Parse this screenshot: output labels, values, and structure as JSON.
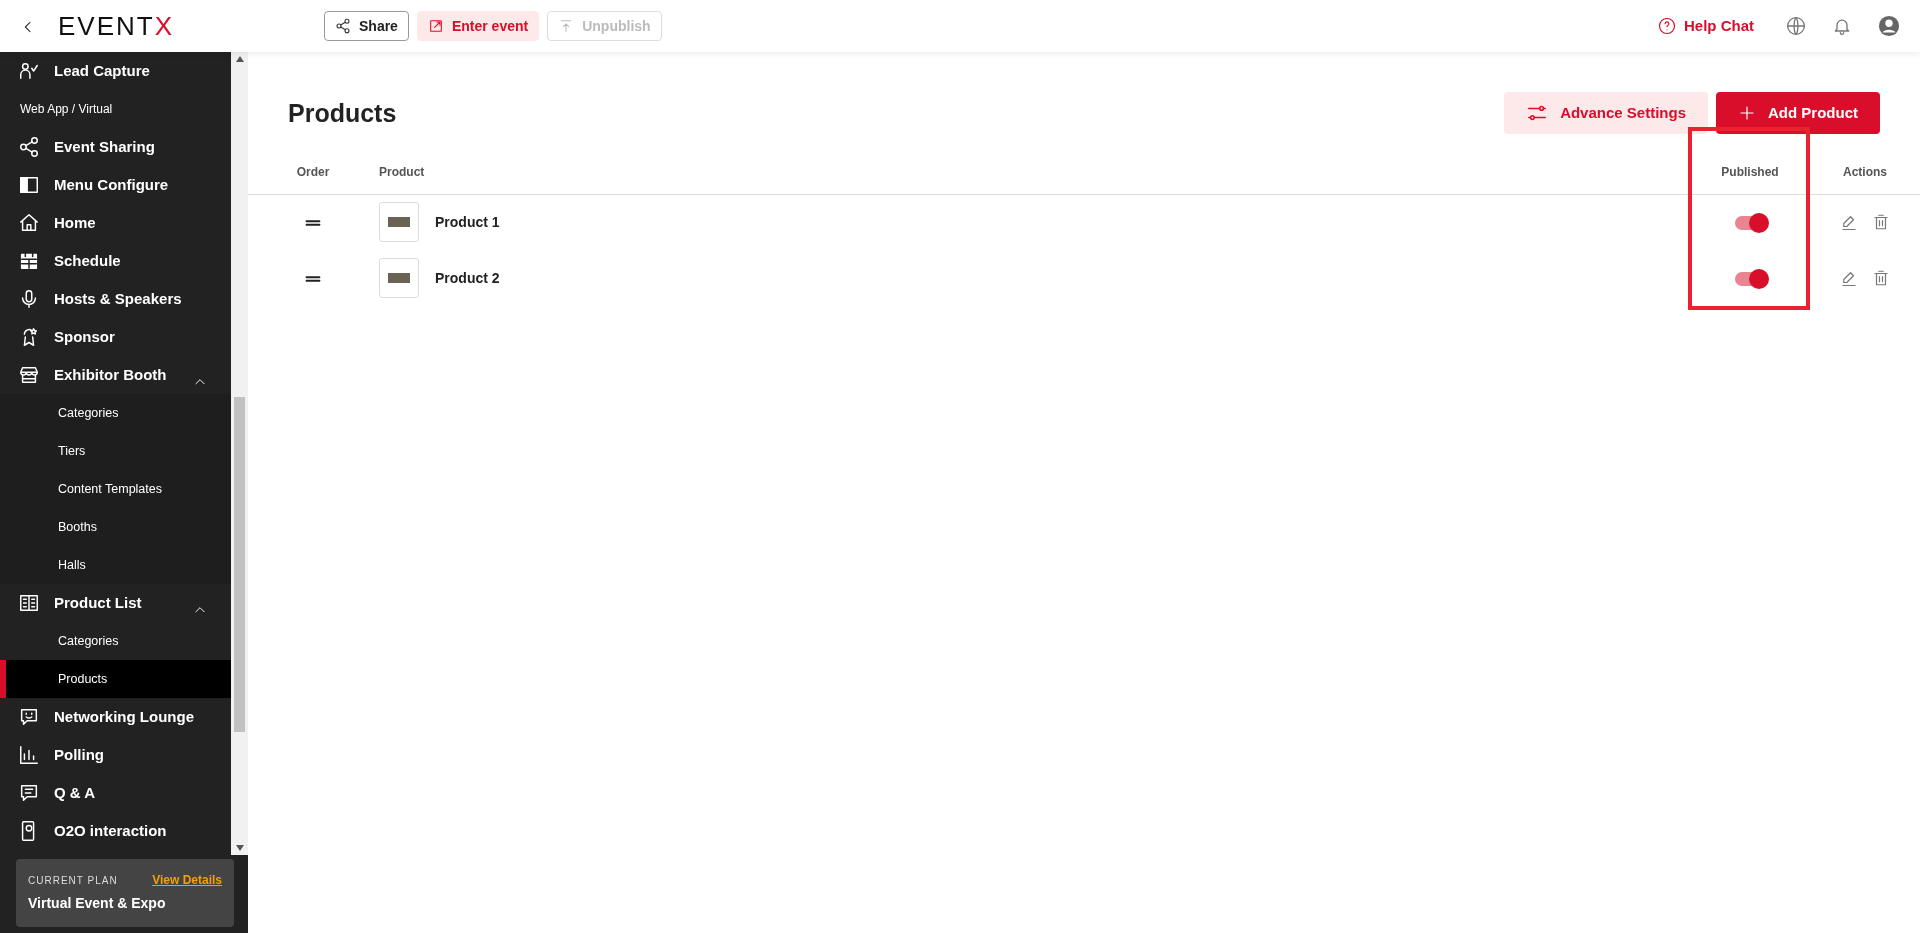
{
  "topbar": {
    "logo": {
      "text": "EVENT",
      "accent": "X"
    },
    "buttons": [
      {
        "label": "Share",
        "kind": "outline",
        "disabled": false
      },
      {
        "label": "Enter event",
        "kind": "soft",
        "disabled": false
      },
      {
        "label": "Unpublish",
        "kind": "outline",
        "disabled": true
      }
    ],
    "help": "Help Chat"
  },
  "sidebar": {
    "items": [
      {
        "kind": "item",
        "label": "Lead Capture",
        "selected": false
      },
      {
        "kind": "section",
        "label": "Web App / Virtual"
      },
      {
        "kind": "item",
        "label": "Event Sharing",
        "selected": false
      },
      {
        "kind": "item",
        "label": "Menu Configure",
        "selected": false
      },
      {
        "kind": "item",
        "label": "Home",
        "selected": false
      },
      {
        "kind": "item",
        "label": "Schedule",
        "selected": false
      },
      {
        "kind": "item",
        "label": "Hosts & Speakers",
        "selected": false
      },
      {
        "kind": "item",
        "label": "Sponsor",
        "selected": false
      },
      {
        "kind": "item",
        "label": "Exhibitor Booth",
        "selected": false,
        "expanded": true,
        "children": [
          {
            "label": "Categories",
            "selected": false
          },
          {
            "label": "Tiers",
            "selected": false
          },
          {
            "label": "Content Templates",
            "selected": false
          },
          {
            "label": "Booths",
            "selected": false
          },
          {
            "label": "Halls",
            "selected": false
          }
        ]
      },
      {
        "kind": "item",
        "label": "Product List",
        "selected": false,
        "expanded": true,
        "children": [
          {
            "label": "Categories",
            "selected": false
          },
          {
            "label": "Products",
            "selected": true
          }
        ]
      },
      {
        "kind": "item",
        "label": "Networking Lounge",
        "selected": false
      },
      {
        "kind": "item",
        "label": "Polling",
        "selected": false
      },
      {
        "kind": "item",
        "label": "Q & A",
        "selected": false
      },
      {
        "kind": "item",
        "label": "O2O interaction",
        "selected": false
      }
    ],
    "plan": {
      "label": "CURRENT PLAN",
      "link": "View Details",
      "name": "Virtual Event & Expo"
    }
  },
  "main": {
    "title": "Products",
    "buttons": [
      {
        "label": "Advance Settings",
        "kind": "soft"
      },
      {
        "label": "Add Product",
        "kind": "primary"
      }
    ],
    "table": {
      "columns": [
        {
          "label": "Order",
          "highlighted": false
        },
        {
          "label": "Product",
          "highlighted": false
        },
        {
          "label": "Published",
          "highlighted": true
        },
        {
          "label": "Actions",
          "highlighted": false
        }
      ],
      "rows": [
        {
          "name": "Product 1",
          "published": true
        },
        {
          "name": "Product 2",
          "published": true
        }
      ]
    }
  }
}
